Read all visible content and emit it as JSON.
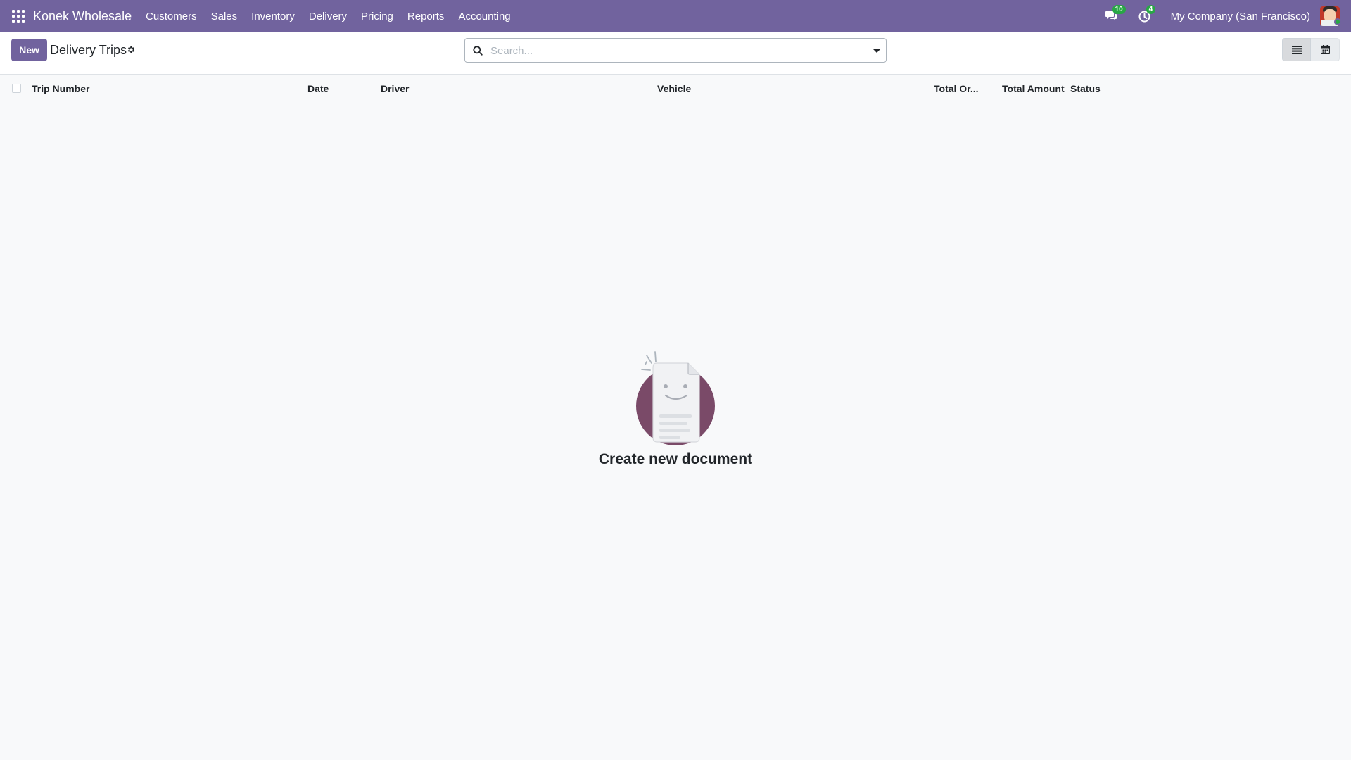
{
  "navbar": {
    "brand": "Konek Wholesale",
    "menu": [
      "Customers",
      "Sales",
      "Inventory",
      "Delivery",
      "Pricing",
      "Reports",
      "Accounting"
    ],
    "messages_count": "10",
    "activities_count": "4",
    "company": "My Company (San Francisco)"
  },
  "control": {
    "new_label": "New",
    "title": "Delivery Trips",
    "search_placeholder": "Search..."
  },
  "list": {
    "columns": [
      "Trip Number",
      "Date",
      "Driver",
      "Vehicle",
      "Total Or...",
      "Total Amount",
      "Status"
    ],
    "rows": []
  },
  "empty_state": {
    "title": "Create new document"
  },
  "colors": {
    "brand": "#71639e",
    "badge": "#28a745",
    "illustration_circle": "#7a4a68"
  },
  "icons": [
    "apps-grid-icon",
    "chat-icon",
    "clock-icon",
    "gear-icon",
    "search-icon",
    "chevron-down-icon",
    "list-view-icon",
    "calendar-view-icon"
  ]
}
